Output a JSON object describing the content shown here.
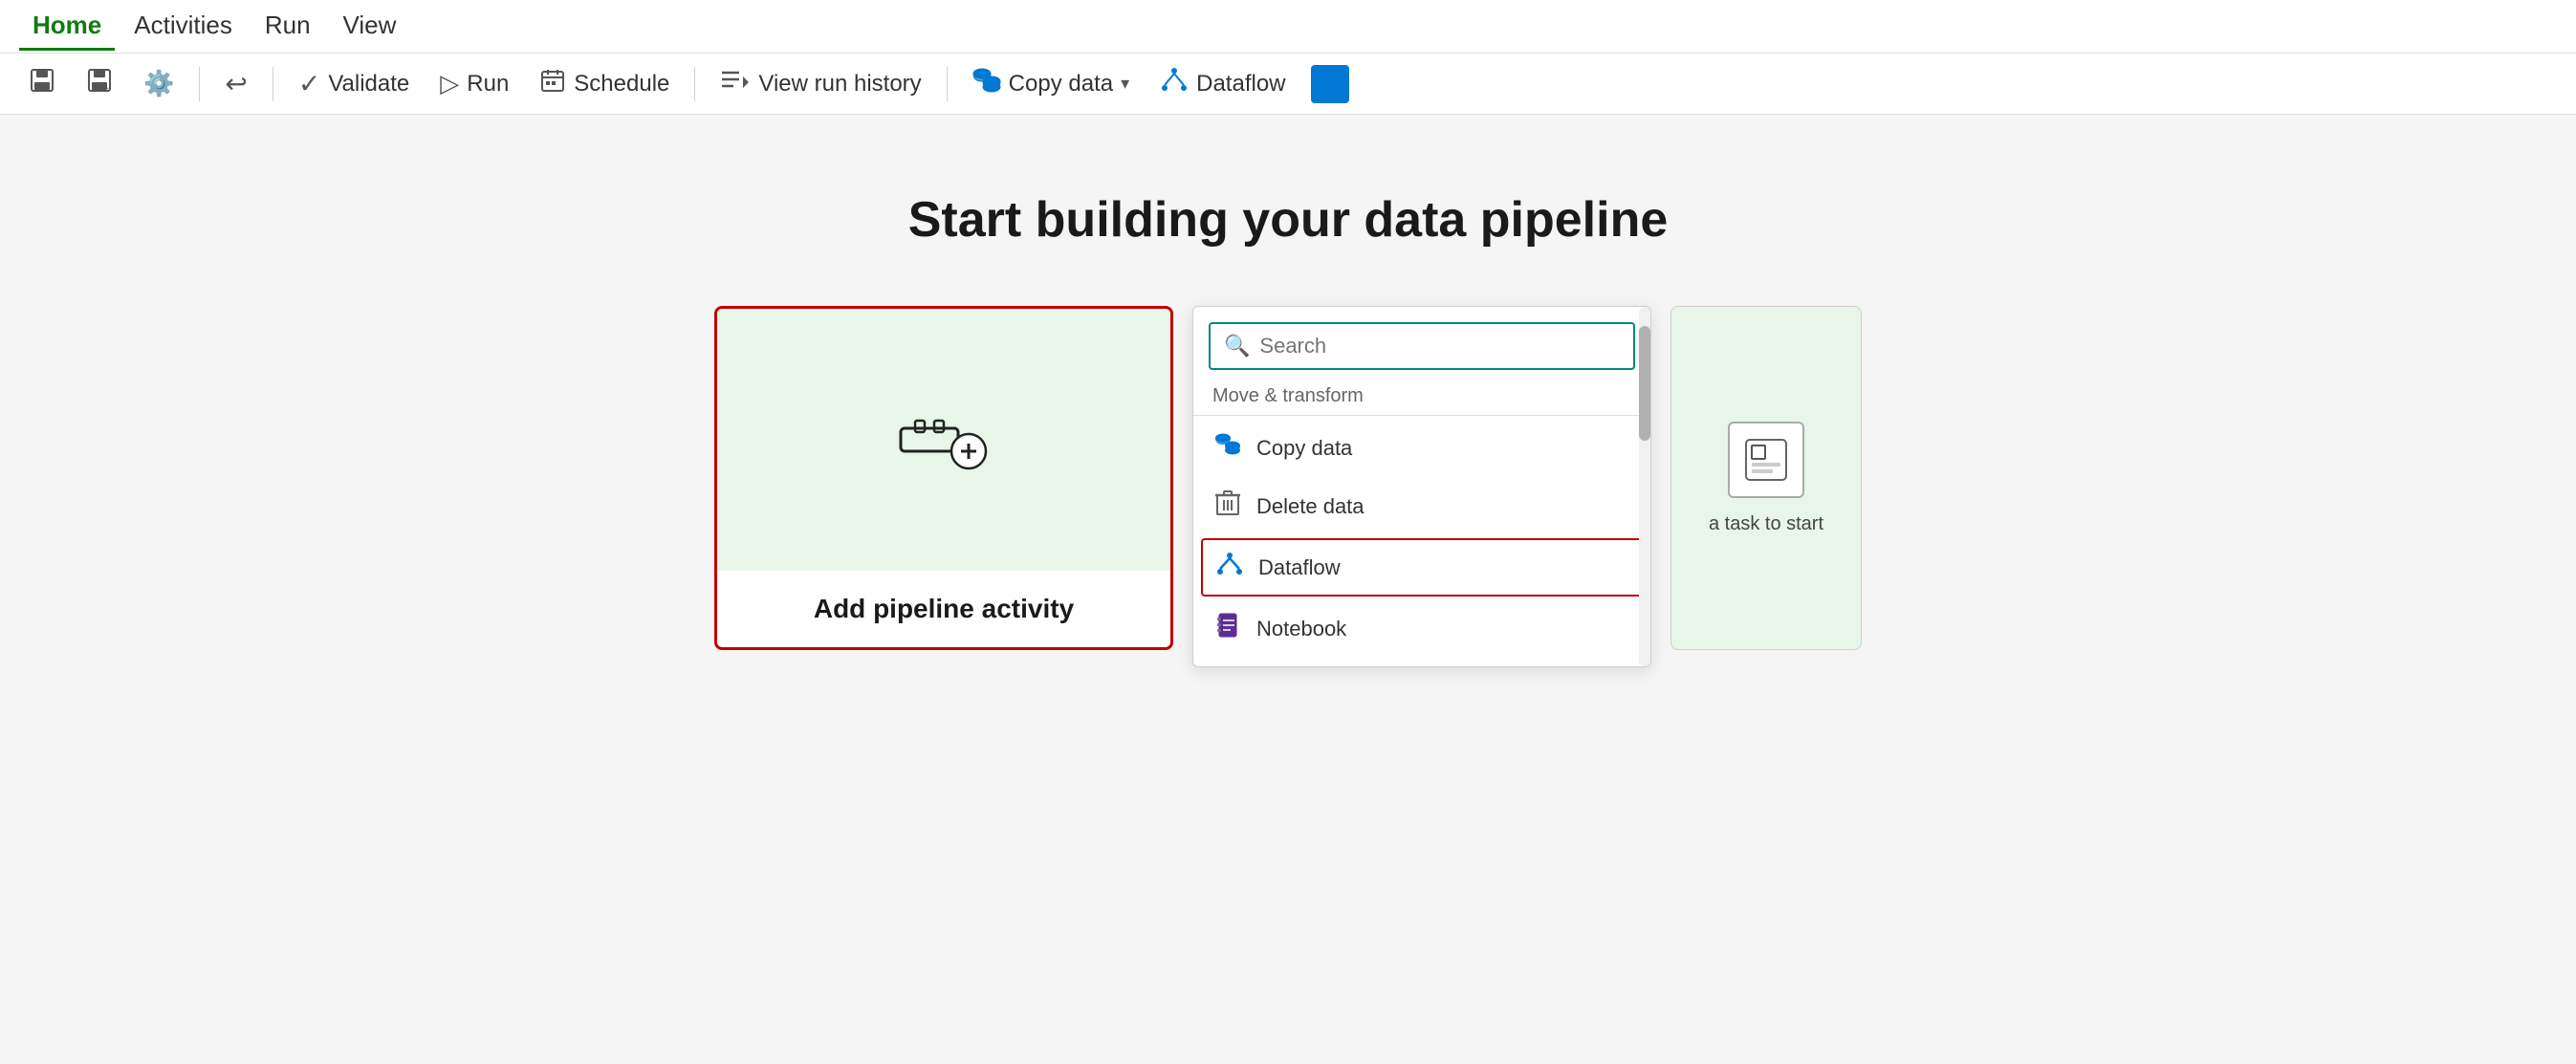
{
  "menubar": {
    "items": [
      {
        "label": "Home",
        "active": true
      },
      {
        "label": "Activities",
        "active": false
      },
      {
        "label": "Run",
        "active": false
      },
      {
        "label": "View",
        "active": false
      }
    ]
  },
  "toolbar": {
    "buttons": [
      {
        "id": "save-icon",
        "icon": "💾",
        "label": "",
        "hasLabel": false
      },
      {
        "id": "save-alt-icon",
        "icon": "📋",
        "label": "",
        "hasLabel": false
      },
      {
        "id": "settings-icon",
        "icon": "⚙️",
        "label": "",
        "hasLabel": false
      },
      {
        "id": "undo-icon",
        "icon": "↩",
        "label": "",
        "hasLabel": false
      },
      {
        "id": "validate-btn",
        "icon": "✓",
        "label": "Validate",
        "hasLabel": true
      },
      {
        "id": "run-btn",
        "icon": "▷",
        "label": "Run",
        "hasLabel": true
      },
      {
        "id": "schedule-btn",
        "icon": "📅",
        "label": "Schedule",
        "hasLabel": true
      },
      {
        "id": "view-run-history-btn",
        "icon": "≡▷",
        "label": "View run history",
        "hasLabel": true
      },
      {
        "id": "copy-data-btn",
        "icon": "🗄",
        "label": "Copy data",
        "hasLabel": true,
        "hasDropdown": true
      },
      {
        "id": "dataflow-btn",
        "icon": "⑂",
        "label": "Dataflow",
        "hasLabel": true
      }
    ]
  },
  "main": {
    "title": "Start building your data pipeline",
    "add_pipeline_label": "Add pipeline activity",
    "search_placeholder": "Search",
    "section_label": "Move & transform",
    "dropdown_items": [
      {
        "id": "copy-data",
        "label": "Copy data",
        "iconType": "blue"
      },
      {
        "id": "delete-data",
        "label": "Delete data",
        "iconType": "gray"
      },
      {
        "id": "dataflow",
        "label": "Dataflow",
        "iconType": "blue",
        "selected": true
      },
      {
        "id": "notebook",
        "label": "Notebook",
        "iconType": "purple"
      }
    ],
    "right_card_text": "a task to start"
  }
}
